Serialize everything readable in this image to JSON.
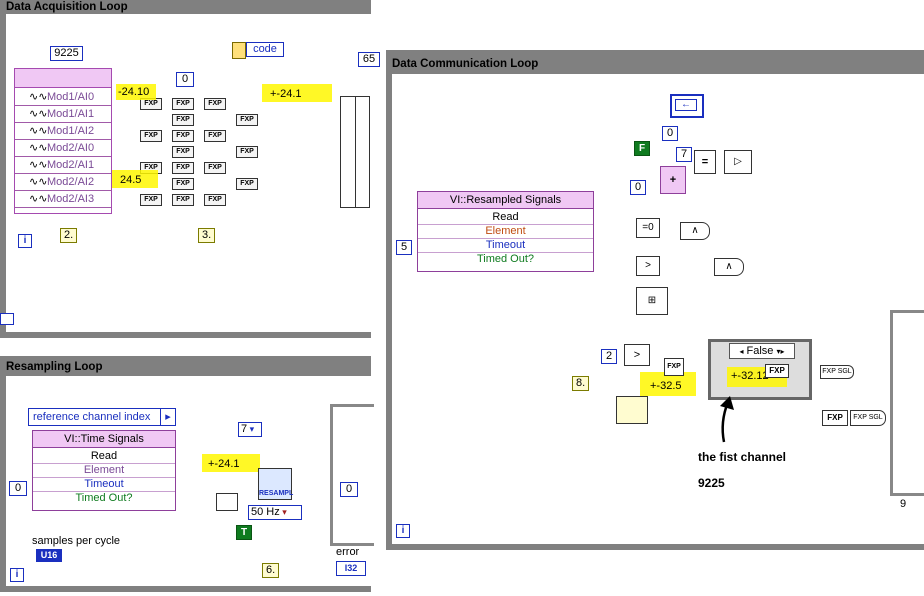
{
  "loops": {
    "acquisition": {
      "title": "Data Acquisition Loop"
    },
    "communication": {
      "title": "Data Communication Loop"
    },
    "resampling": {
      "title": "Resampling Loop"
    }
  },
  "acquisition": {
    "device_constant": "9225",
    "code_label": "code",
    "right_cut_const": "65",
    "zero_const": "0",
    "channels": [
      "Mod1/AI0",
      "Mod1/AI1",
      "Mod1/AI2",
      "Mod2/AI0",
      "Mod2/AI1",
      "Mod2/AI2",
      "Mod2/AI3"
    ],
    "highlight_values": [
      "-24.10",
      "+-24.1",
      "24.5"
    ],
    "fxp_label": "FXP",
    "step_labels": [
      "2.",
      "3."
    ]
  },
  "communication": {
    "queue": {
      "title": "VI::Resampled Signals",
      "rows": [
        "Read",
        "Element",
        "Timeout",
        "Timed Out?"
      ]
    },
    "timeout_const": "5",
    "const_zero_a": "0",
    "const_zero_b": "0",
    "const_seven": "7",
    "bool_false_const": "F",
    "const_two": "2",
    "case_selector": "False",
    "highlight_values": [
      "+-32.5",
      "+-32.12"
    ],
    "step_label": "8.",
    "annotation_line1": "the fist channel",
    "annotation_line2": "9225",
    "fxp_label": "FXP",
    "sgl_label": "FXP SGL",
    "right_cut_digit": "9"
  },
  "resampling": {
    "index_label": "reference channel index",
    "queue": {
      "title": "VI::Time Signals",
      "rows": [
        "Read",
        "Element",
        "Timeout",
        "Timed Out?"
      ]
    },
    "timeout_const": "0",
    "ring_value": "7",
    "highlight_value": "+-24.1",
    "resample_label": "RESAMPL",
    "freq_value": "50 Hz",
    "bool_true_const": "T",
    "samples_label": "samples per cycle",
    "u16_label": "U16",
    "error_label": "error",
    "i32_label": "I32",
    "step_label": "6.",
    "case_zero": "0"
  },
  "colors": {
    "frame": "#808080",
    "wire_blue": "#1a2fbf",
    "wire_green": "#0f7b1f",
    "wire_orange": "#c06018",
    "highlight": "#fff700",
    "queue_pink": "#f0c8f4"
  }
}
